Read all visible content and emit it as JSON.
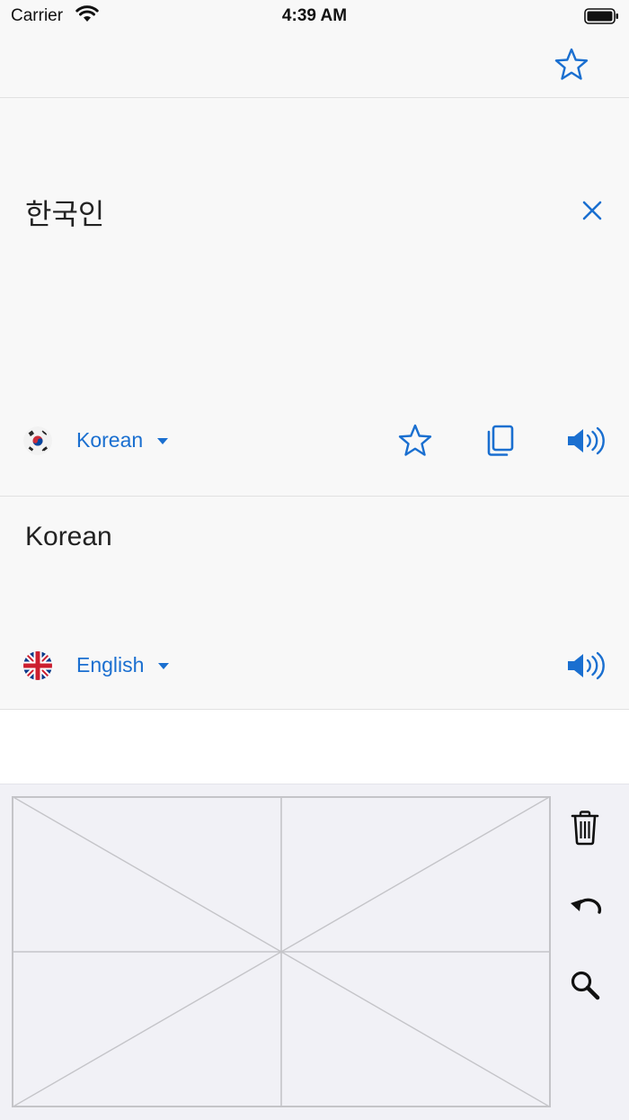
{
  "status_bar": {
    "carrier": "Carrier",
    "time": "4:39 AM"
  },
  "source": {
    "text": "한국인",
    "language": "Korean",
    "flag": "south-korea-flag"
  },
  "target": {
    "text": "Korean",
    "language": "English",
    "flag": "uk-flag"
  },
  "colors": {
    "accent": "#1a6fd0",
    "panel_bg": "#f8f8f8",
    "draw_bg": "#f1f1f6"
  },
  "icons": [
    "star-icon",
    "close-icon",
    "copy-icon",
    "speaker-icon",
    "trash-icon",
    "undo-icon",
    "search-icon"
  ]
}
